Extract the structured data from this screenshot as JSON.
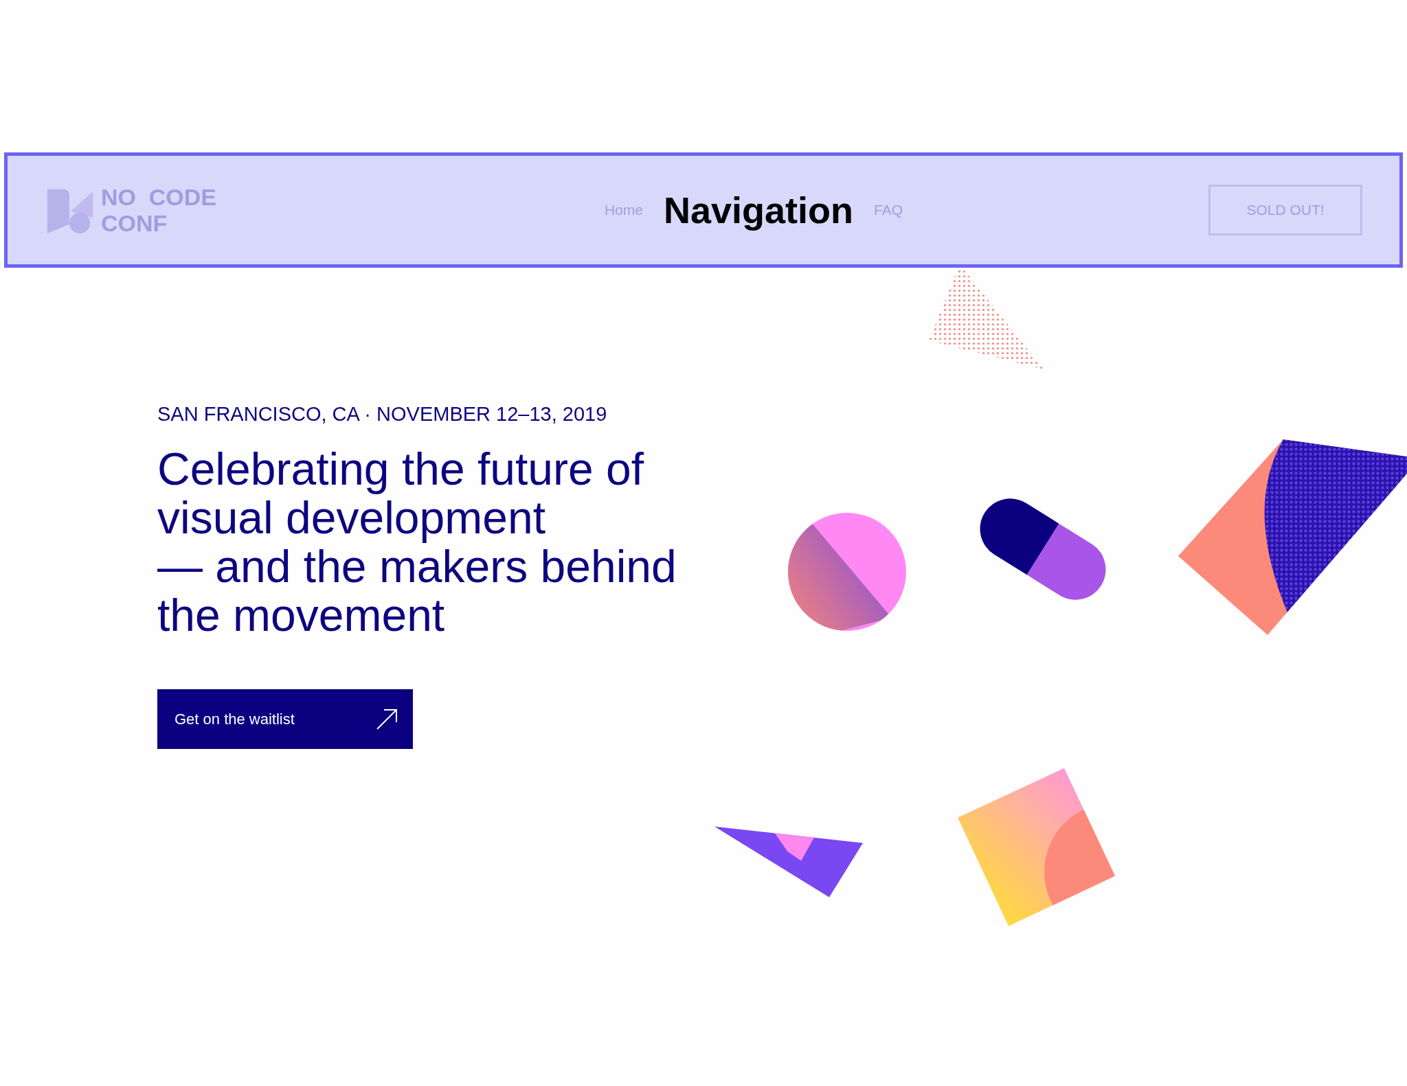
{
  "annotation": {
    "label": "Navigation"
  },
  "nav": {
    "logo_lines": [
      "NO  CODE",
      "CONF"
    ],
    "links": [
      "Home",
      "FAQ"
    ],
    "button": "SOLD OUT!"
  },
  "hero": {
    "eyebrow": "SAN FRANCISCO, CA · NOVEMBER 12–13, 2019",
    "headline_lines": [
      "Celebrating the future of",
      "visual development",
      "— and the makers behind",
      "the movement"
    ],
    "cta": "Get on the waitlist"
  }
}
